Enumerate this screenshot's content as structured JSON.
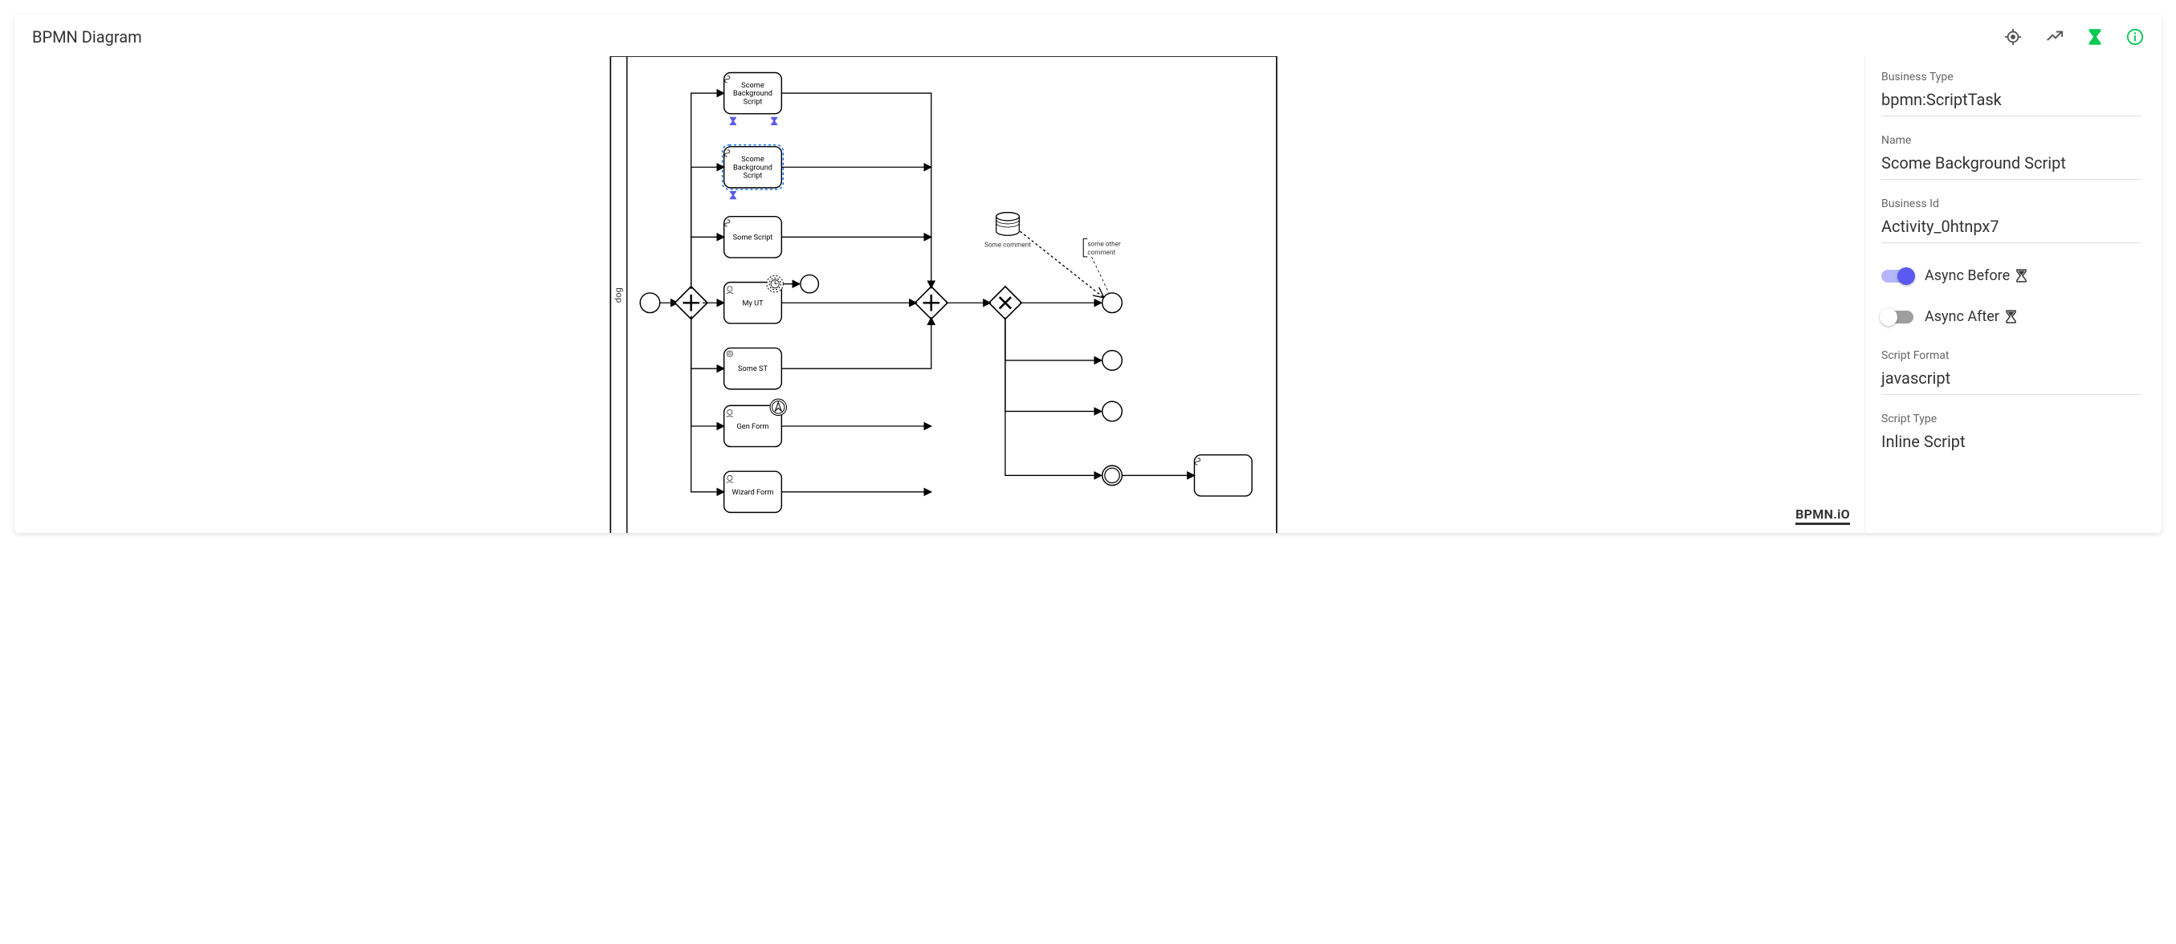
{
  "header": {
    "title": "BPMN Diagram"
  },
  "toolbar_icons": {
    "locate": "locate-icon",
    "cancel_edit": "cancel-edit-icon",
    "hourglass": "hourglass-icon",
    "info": "info-icon"
  },
  "diagram": {
    "lane_label": "dog",
    "tasks": [
      {
        "id": "t1",
        "label_line1": "Scome",
        "label_line2": "Background",
        "label_line3": "Script",
        "type": "script",
        "async_markers": 2
      },
      {
        "id": "t2",
        "label_line1": "Scome",
        "label_line2": "Background",
        "label_line3": "Script",
        "type": "script",
        "selected": true,
        "async_markers": 1
      },
      {
        "id": "t3",
        "label": "Some Script",
        "type": "script"
      },
      {
        "id": "t4",
        "label": "My UT",
        "type": "user",
        "boundary": "timer"
      },
      {
        "id": "t5",
        "label": "Some ST",
        "type": "service"
      },
      {
        "id": "t6",
        "label": "Gen Form",
        "type": "user",
        "boundary": "escalation"
      },
      {
        "id": "t7",
        "label": "Wizard Form",
        "type": "user"
      },
      {
        "id": "t8",
        "label": "",
        "type": "script"
      }
    ],
    "data_store": {
      "label": "Some comment"
    },
    "annotation": {
      "line1": "some other",
      "line2": "comment"
    },
    "logo_text": "BPMN.iO"
  },
  "properties": {
    "fields": [
      {
        "label": "Business Type",
        "value": "bpmn:ScriptTask"
      },
      {
        "label": "Name",
        "value": "Scome Background Script"
      },
      {
        "label": "Business Id",
        "value": "Activity_0htnpx7"
      }
    ],
    "toggles": [
      {
        "label": "Async Before",
        "on": true
      },
      {
        "label": "Async After",
        "on": false
      }
    ],
    "fields2": [
      {
        "label": "Script Format",
        "value": "javascript"
      }
    ],
    "fields_cut": [
      {
        "label": "Script Type",
        "value": "Inline Script"
      }
    ]
  }
}
